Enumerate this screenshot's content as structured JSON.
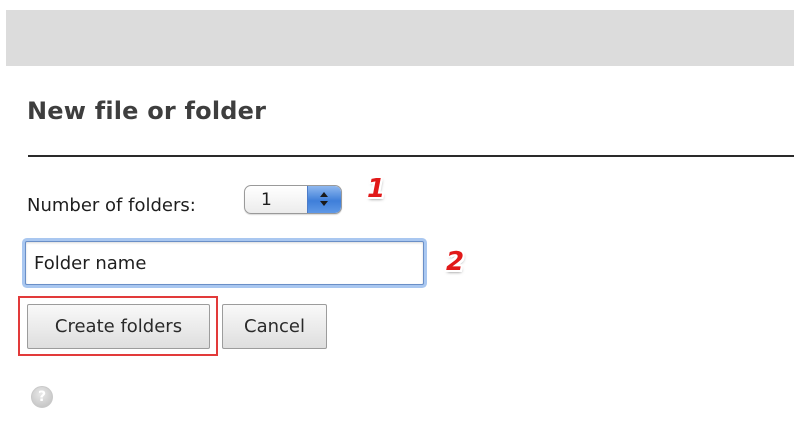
{
  "header": {
    "title": "New file or folder"
  },
  "form": {
    "count_label": "Number of folders:",
    "count_value": "1",
    "name_value": "Folder name",
    "create_label": "Create folders",
    "cancel_label": "Cancel"
  },
  "annotations": {
    "step1": "1",
    "step2": "2",
    "highlight_color": "#e23a3a",
    "marker_color": "#e11919"
  },
  "icons": {
    "help": "help-icon",
    "help_glyph": "?",
    "stepper": "stepper-arrows-icon"
  },
  "colors": {
    "top_bar": "#dcdcdc",
    "focus_ring": "#a9c7f0",
    "stepper_blue": "#3f7fd9"
  }
}
